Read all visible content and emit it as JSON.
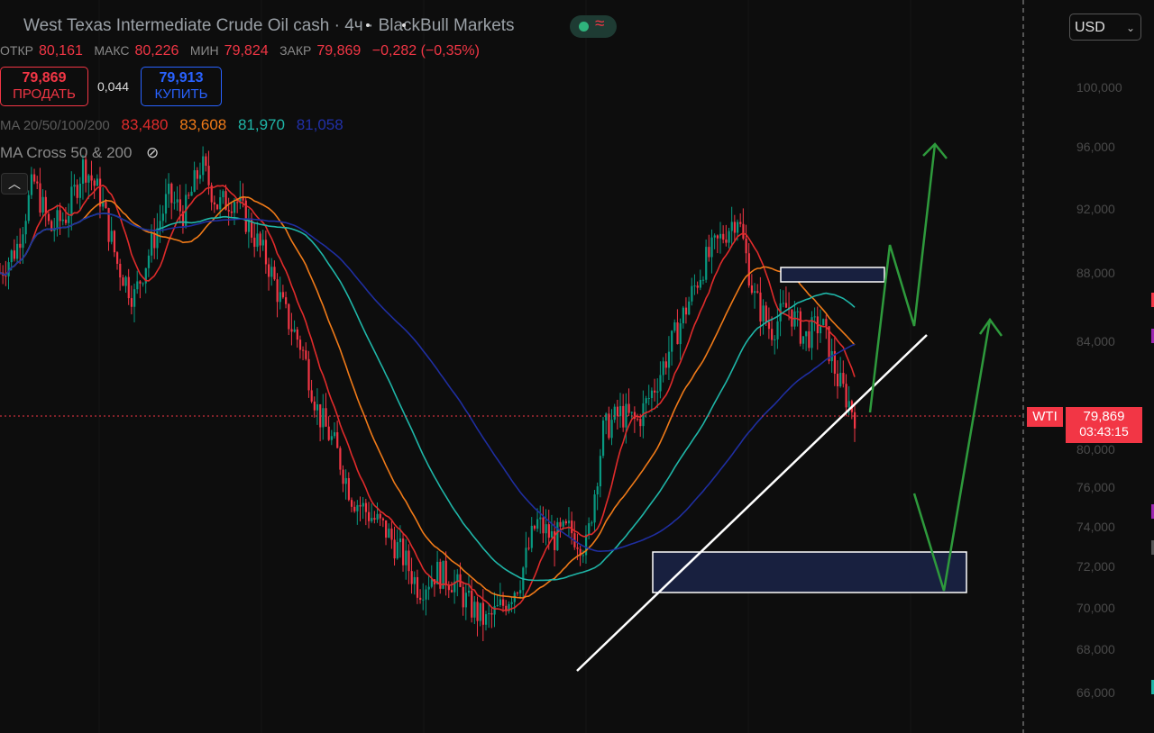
{
  "header": {
    "title": "West Texas Intermediate Crude Oil cash · 4ч · BlackBull Markets",
    "ohlc": [
      {
        "key": "ОТКР",
        "value": "80,161"
      },
      {
        "key": "МАКС",
        "value": "80,226"
      },
      {
        "key": "МИН",
        "value": "79,824"
      },
      {
        "key": "ЗАКР",
        "value": "79,869"
      }
    ],
    "change": "−0,282 (−0,35%)"
  },
  "trade": {
    "sell_price": "79,869",
    "sell_label": "ПРОДАТЬ",
    "spread": "0,044",
    "buy_price": "79,913",
    "buy_label": "КУПИТЬ"
  },
  "indicators": {
    "ma_name": "MA 20/50/100/200",
    "ma_values": [
      "83,480",
      "83,608",
      "81,970",
      "81,058"
    ],
    "cross_name": "MA Cross 50 & 200"
  },
  "currency": "USD",
  "y_axis_labels": [
    "100,000",
    "96,000",
    "92,000",
    "88,000",
    "84,000",
    "80,000",
    "76,000",
    "74,000",
    "72,000",
    "70,000",
    "68,000",
    "66,000"
  ],
  "last_price": {
    "symbol": "WTI",
    "price": "79,869",
    "countdown": "03:43:15"
  },
  "colors": {
    "up": "#089981",
    "down": "#f23645",
    "ma20": "#e02b2b",
    "ma50": "#f07a18",
    "ma100": "#1fb6a8",
    "ma200": "#1f2ea0",
    "zone": "#18203f",
    "arrow": "#2e9a3c",
    "trendline": "#ffffff"
  },
  "chart_data": {
    "type": "candlestick",
    "y_axis_labels_printed": [
      "100,000",
      "96,000",
      "92,000",
      "88,000",
      "84,000",
      "80,000",
      "76,000",
      "74,000",
      "72,000",
      "70,000",
      "68,000",
      "66,000"
    ],
    "close_trace": [
      88.5,
      90,
      94,
      91,
      92,
      95,
      93,
      89,
      87,
      90,
      93,
      92,
      95,
      92.5,
      93,
      91,
      89,
      86,
      84,
      80,
      78,
      75,
      74,
      73,
      71.5,
      69.5,
      70.5,
      70,
      68.5,
      67.5,
      68.5,
      70,
      73.5,
      72.5,
      73,
      72,
      79,
      80,
      79.5,
      81.5,
      84,
      86.5,
      89,
      90.5,
      92,
      87,
      85,
      86.5,
      84.5,
      85.5,
      82,
      80
    ],
    "last": 79.869,
    "zones": [
      {
        "top": 88.0,
        "bottom": 87.1
      },
      {
        "top": 72.8,
        "bottom": 70.5
      }
    ],
    "trendline": [
      {
        "index": 0,
        "price": 67.5
      },
      {
        "index": 1,
        "price": 84.3
      }
    ],
    "scenario_arrows": 3
  }
}
